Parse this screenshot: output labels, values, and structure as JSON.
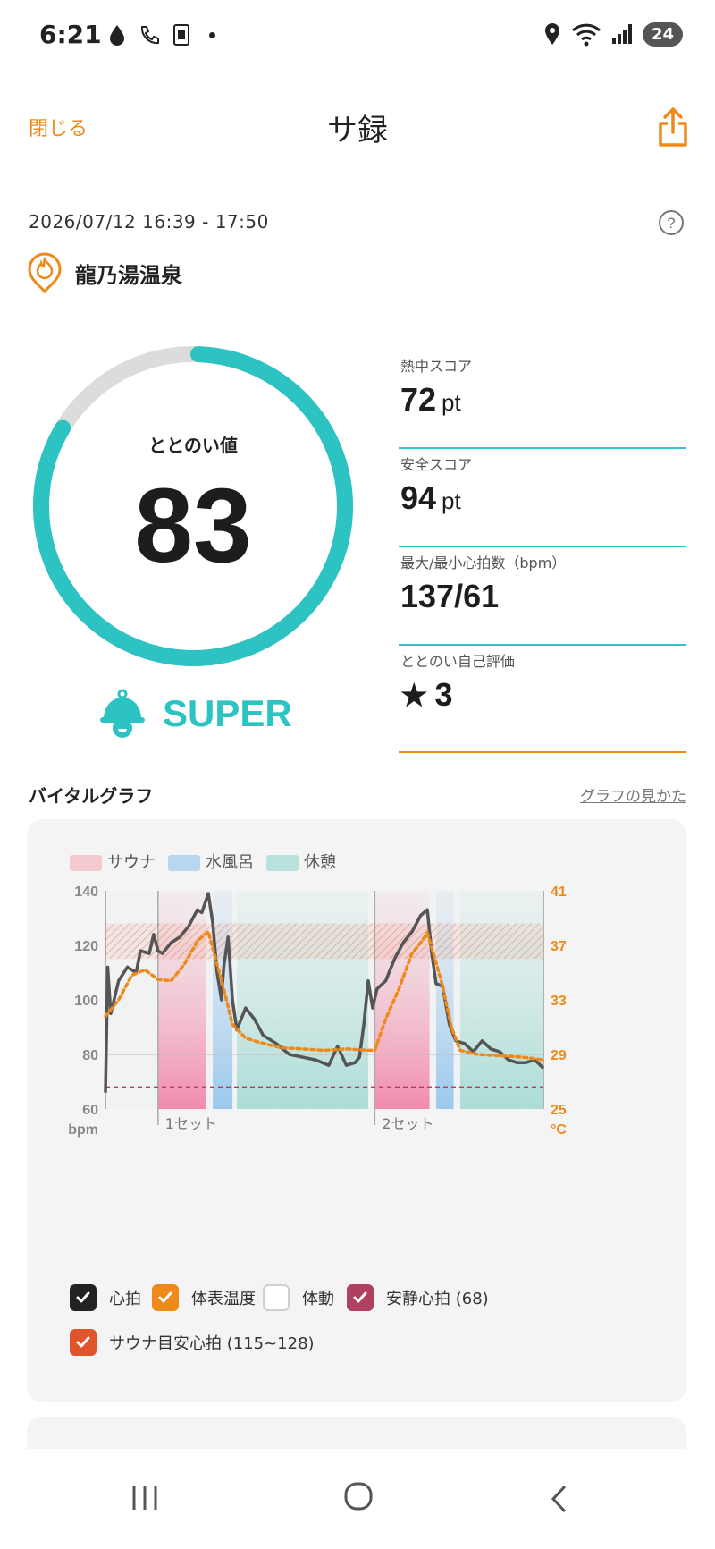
{
  "status_bar": {
    "time": "6:21",
    "battery": "24"
  },
  "header": {
    "close_label": "閉じる",
    "title": "サ録"
  },
  "session": {
    "datetime": "2026/07/12 16:39 - 17:50",
    "place": "龍乃湯温泉"
  },
  "score": {
    "label": "ととのい値",
    "value": "83",
    "rank": "SUPER",
    "fraction": 0.83,
    "ring_color": "#2ec3c3"
  },
  "stats": [
    {
      "label": "熱中スコア",
      "value": "72",
      "unit": "pt"
    },
    {
      "label": "安全スコア",
      "value": "94",
      "unit": "pt"
    },
    {
      "label": "最大/最小心拍数（bpm）",
      "value": "137/61",
      "unit": ""
    },
    {
      "label": "ととのい自己評価",
      "value": "3",
      "unit": "",
      "star": "★"
    }
  ],
  "vital": {
    "title": "バイタルグラフ",
    "help_link": "グラフの見かた",
    "legend": [
      {
        "label": "サウナ",
        "color": "#f4c9d0"
      },
      {
        "label": "水風呂",
        "color": "#b7d7ef"
      },
      {
        "label": "休憩",
        "color": "#b8e2dc"
      }
    ],
    "checks": [
      {
        "label": "心拍",
        "color": "#222222",
        "checked": true
      },
      {
        "label": "体表温度",
        "color": "#ef8a1a",
        "checked": true
      },
      {
        "label": "体動",
        "color": "#ffffff",
        "checked": false
      },
      {
        "label": "安静心拍 (68)",
        "color": "#b0405f",
        "checked": true
      },
      {
        "label": "サウナ目安心拍 (115~128)",
        "color": "#e0542a",
        "checked": true
      }
    ]
  },
  "chart_data": {
    "type": "line",
    "left_axis_ticks": [
      "140",
      "120",
      "100",
      "80",
      "60"
    ],
    "left_unit": "bpm",
    "right_axis_ticks": [
      "41",
      "37",
      "33",
      "29",
      "25"
    ],
    "right_unit": "°C",
    "ylim_left": [
      60,
      140
    ],
    "ylim_right": [
      25,
      41
    ],
    "x_set_labels": [
      "1セット",
      "2セット"
    ],
    "phases": [
      {
        "type": "sauna",
        "start": 0.12,
        "end": 0.23
      },
      {
        "type": "cold",
        "start": 0.245,
        "end": 0.29
      },
      {
        "type": "rest",
        "start": 0.3,
        "end": 0.6
      },
      {
        "type": "sauna",
        "start": 0.615,
        "end": 0.74
      },
      {
        "type": "cold",
        "start": 0.755,
        "end": 0.795
      },
      {
        "type": "rest",
        "start": 0.81,
        "end": 1.0
      }
    ],
    "set_markers": [
      0.12,
      0.615
    ],
    "resting_hr": 68,
    "sauna_target_hr": [
      115,
      128
    ],
    "series": [
      {
        "name": "心拍",
        "color": "#555555",
        "points": [
          [
            0.0,
            66
          ],
          [
            0.005,
            112
          ],
          [
            0.012,
            95
          ],
          [
            0.03,
            107
          ],
          [
            0.05,
            112
          ],
          [
            0.07,
            110
          ],
          [
            0.08,
            118
          ],
          [
            0.1,
            117
          ],
          [
            0.11,
            124
          ],
          [
            0.12,
            118
          ],
          [
            0.13,
            117
          ],
          [
            0.15,
            121
          ],
          [
            0.17,
            123
          ],
          [
            0.19,
            127
          ],
          [
            0.21,
            133
          ],
          [
            0.22,
            132
          ],
          [
            0.235,
            139
          ],
          [
            0.245,
            128
          ],
          [
            0.255,
            110
          ],
          [
            0.265,
            100
          ],
          [
            0.27,
            112
          ],
          [
            0.28,
            123
          ],
          [
            0.29,
            100
          ],
          [
            0.3,
            89
          ],
          [
            0.32,
            97
          ],
          [
            0.34,
            93
          ],
          [
            0.36,
            87
          ],
          [
            0.39,
            84
          ],
          [
            0.42,
            80
          ],
          [
            0.45,
            79
          ],
          [
            0.48,
            78
          ],
          [
            0.51,
            76
          ],
          [
            0.53,
            83
          ],
          [
            0.55,
            76
          ],
          [
            0.57,
            77
          ],
          [
            0.58,
            79
          ],
          [
            0.59,
            91
          ],
          [
            0.6,
            107
          ],
          [
            0.61,
            97
          ],
          [
            0.62,
            104
          ],
          [
            0.64,
            107
          ],
          [
            0.66,
            115
          ],
          [
            0.68,
            121
          ],
          [
            0.7,
            125
          ],
          [
            0.72,
            131
          ],
          [
            0.735,
            133
          ],
          [
            0.745,
            117
          ],
          [
            0.755,
            106
          ],
          [
            0.77,
            105
          ],
          [
            0.785,
            91
          ],
          [
            0.8,
            85
          ],
          [
            0.82,
            84
          ],
          [
            0.84,
            81
          ],
          [
            0.86,
            85
          ],
          [
            0.88,
            82
          ],
          [
            0.9,
            81
          ],
          [
            0.92,
            78
          ],
          [
            0.94,
            77
          ],
          [
            0.96,
            77
          ],
          [
            0.98,
            78
          ],
          [
            1.0,
            75
          ]
        ]
      },
      {
        "name": "体表温度",
        "color": "#ef8a1a",
        "points": [
          [
            0.0,
            31.8
          ],
          [
            0.03,
            33.0
          ],
          [
            0.06,
            34.8
          ],
          [
            0.09,
            35.2
          ],
          [
            0.12,
            34.5
          ],
          [
            0.15,
            34.4
          ],
          [
            0.18,
            35.6
          ],
          [
            0.21,
            37.3
          ],
          [
            0.235,
            38.0
          ],
          [
            0.25,
            36.2
          ],
          [
            0.27,
            33.8
          ],
          [
            0.29,
            31.2
          ],
          [
            0.32,
            30.2
          ],
          [
            0.35,
            29.9
          ],
          [
            0.4,
            29.5
          ],
          [
            0.45,
            29.4
          ],
          [
            0.5,
            29.3
          ],
          [
            0.55,
            29.4
          ],
          [
            0.6,
            29.3
          ],
          [
            0.615,
            29.3
          ],
          [
            0.64,
            31.6
          ],
          [
            0.67,
            33.8
          ],
          [
            0.7,
            36.4
          ],
          [
            0.72,
            37.2
          ],
          [
            0.735,
            37.9
          ],
          [
            0.75,
            36.3
          ],
          [
            0.77,
            34.0
          ],
          [
            0.79,
            31.0
          ],
          [
            0.81,
            29.3
          ],
          [
            0.85,
            29.0
          ],
          [
            0.9,
            28.9
          ],
          [
            0.95,
            28.8
          ],
          [
            1.0,
            28.6
          ]
        ]
      }
    ]
  }
}
